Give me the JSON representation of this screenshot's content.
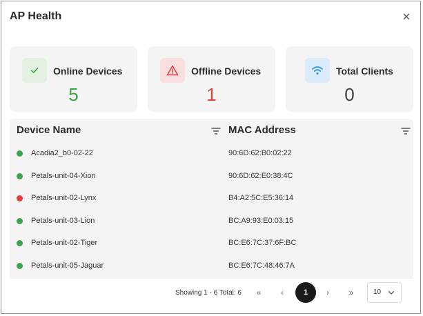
{
  "dialog": {
    "title": "AP Health"
  },
  "cards": {
    "online": {
      "label": "Online Devices",
      "value": "5",
      "color": "#3aa64a"
    },
    "offline": {
      "label": "Offline Devices",
      "value": "1",
      "color": "#e0403a"
    },
    "clients": {
      "label": "Total Clients",
      "value": "0",
      "color": "#444444"
    }
  },
  "table": {
    "columns": {
      "device_name": "Device Name",
      "mac_address": "MAC Address"
    },
    "rows": [
      {
        "device": "Acadia2_b0-02-22",
        "mac": "90:6D:62:B0:02:22",
        "status": "online"
      },
      {
        "device": "Petals-unit-04-Xion",
        "mac": "90:6D:62:E0:38:4C",
        "status": "online"
      },
      {
        "device": "Petals-unit-02-Lynx",
        "mac": "B4:A2:5C:E5:36:14",
        "status": "offline"
      },
      {
        "device": "Petals-unit-03-Lion",
        "mac": "BC:A9:93:E0:03:15",
        "status": "online"
      },
      {
        "device": "Petals-unit-02-Tiger",
        "mac": "BC:E6:7C:37:6F:BC",
        "status": "online"
      },
      {
        "device": "Petals-unit-05-Jaguar",
        "mac": "BC:E6:7C:48:46:7A",
        "status": "online"
      }
    ]
  },
  "status_colors": {
    "online": "#3aa64a",
    "offline": "#e0403a"
  },
  "pagination": {
    "showing": "Showing 1 - 6 Total: 6",
    "first": "«",
    "prev": "‹",
    "current_page": "1",
    "next": "›",
    "last": "»",
    "page_size": "10"
  },
  "icons": {
    "close": "close-icon",
    "online": "check-icon",
    "offline": "warning-triangle-icon",
    "clients": "wifi-icon",
    "filter": "filter-icon",
    "page_size": "chevron-down-icon"
  }
}
